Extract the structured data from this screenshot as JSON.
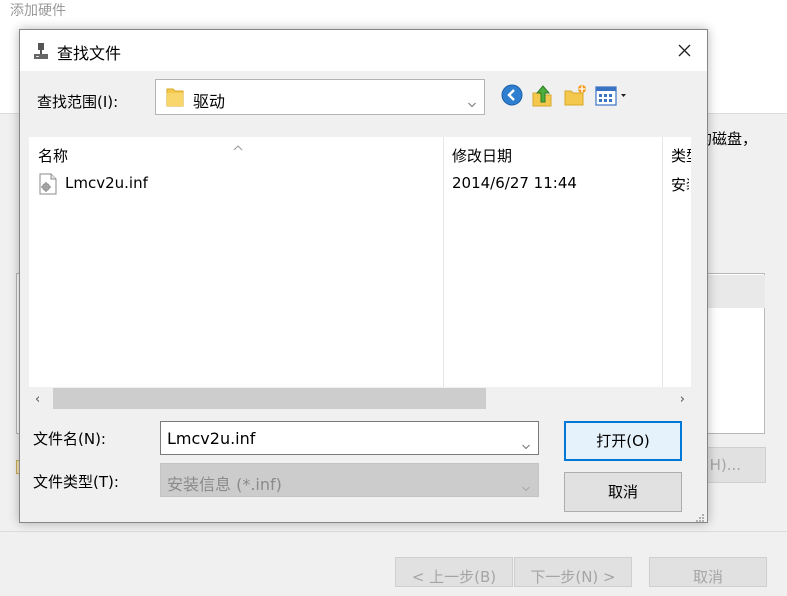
{
  "background_wizard": {
    "title": "添加硬件",
    "peek_text": "的磁盘，",
    "have_disk_label_fragment": "H)...",
    "back_button": "< 上一步(B)",
    "next_button": "下一步(N) >",
    "cancel_button": "取消"
  },
  "dialog": {
    "title": "查找文件",
    "look_in": {
      "label": "查找范围(I):",
      "value": "驱动"
    },
    "toolbar_icons": [
      "back-icon",
      "up-folder-icon",
      "new-folder-icon",
      "view-menu-icon"
    ],
    "file_list": {
      "columns": [
        "名称",
        "修改日期",
        "类型"
      ],
      "rows": [
        {
          "name": "Lmcv2u.inf",
          "modified": "2014/6/27 11:44",
          "type": "安装信息"
        }
      ]
    },
    "file_name": {
      "label": "文件名(N):",
      "value": "Lmcv2u.inf"
    },
    "file_type": {
      "label": "文件类型(T):",
      "value": "安装信息 (*.inf)"
    },
    "open_button": "打开(O)",
    "cancel_button": "取消"
  },
  "colors": {
    "accent": "#0078d7",
    "folder_yellow": "#f4c84c"
  }
}
